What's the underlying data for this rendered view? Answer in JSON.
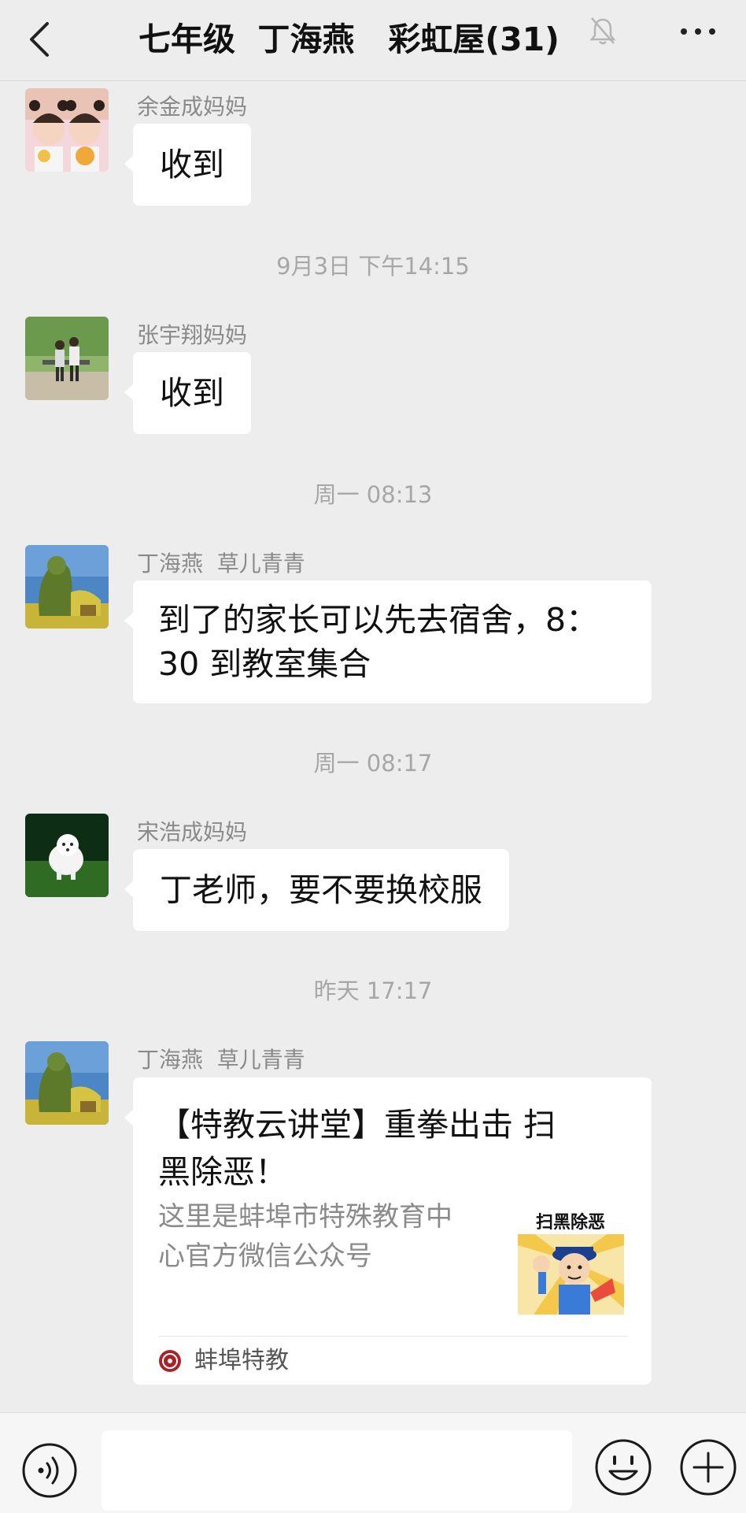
{
  "header": {
    "title": "七年级  丁海燕   彩虹屋(31)",
    "icons": [
      "back-icon",
      "mute-bell-icon",
      "more-icon"
    ]
  },
  "messages": [
    {
      "sender": "余金成妈妈",
      "text": "收到",
      "avatar": "two-girls-photo"
    },
    {
      "time": "9月3日 下午14:15"
    },
    {
      "sender": "张宇翔妈妈",
      "text": "收到",
      "avatar": "two-people-outdoor-photo"
    },
    {
      "time": "周一 08:13"
    },
    {
      "sender": "丁海燕  草儿青青",
      "lines": [
        "到了的家长可以先去宿舍，8：",
        "30 到教室集合"
      ],
      "avatar": "hedge-sculpture-photo"
    },
    {
      "time": "周一 08:17"
    },
    {
      "sender": "宋浩成妈妈",
      "text": "丁老师，要不要换校服",
      "avatar": "white-dog-photo"
    },
    {
      "time": "昨天 17:17"
    },
    {
      "sender": "丁海燕  草儿青青",
      "avatar": "hedge-sculpture-photo",
      "card": {
        "title_lines": [
          "【特教云讲堂】重拳出击 扫",
          "黑除恶！"
        ],
        "desc_lines": [
          "这里是蚌埠市特殊教育中",
          "心官方微信公众号"
        ],
        "thumb_text": "扫黑除恶",
        "source": "蚌埠特教"
      }
    }
  ],
  "input": {
    "placeholder": "",
    "value": ""
  },
  "toolbar": {
    "icons": [
      "voice-icon",
      "emoji-icon",
      "plus-icon"
    ]
  },
  "colors": {
    "background": "#ededed",
    "bubble": "#ffffff",
    "timestamp": "#a7a7a7",
    "sender": "#8a8a8a"
  }
}
